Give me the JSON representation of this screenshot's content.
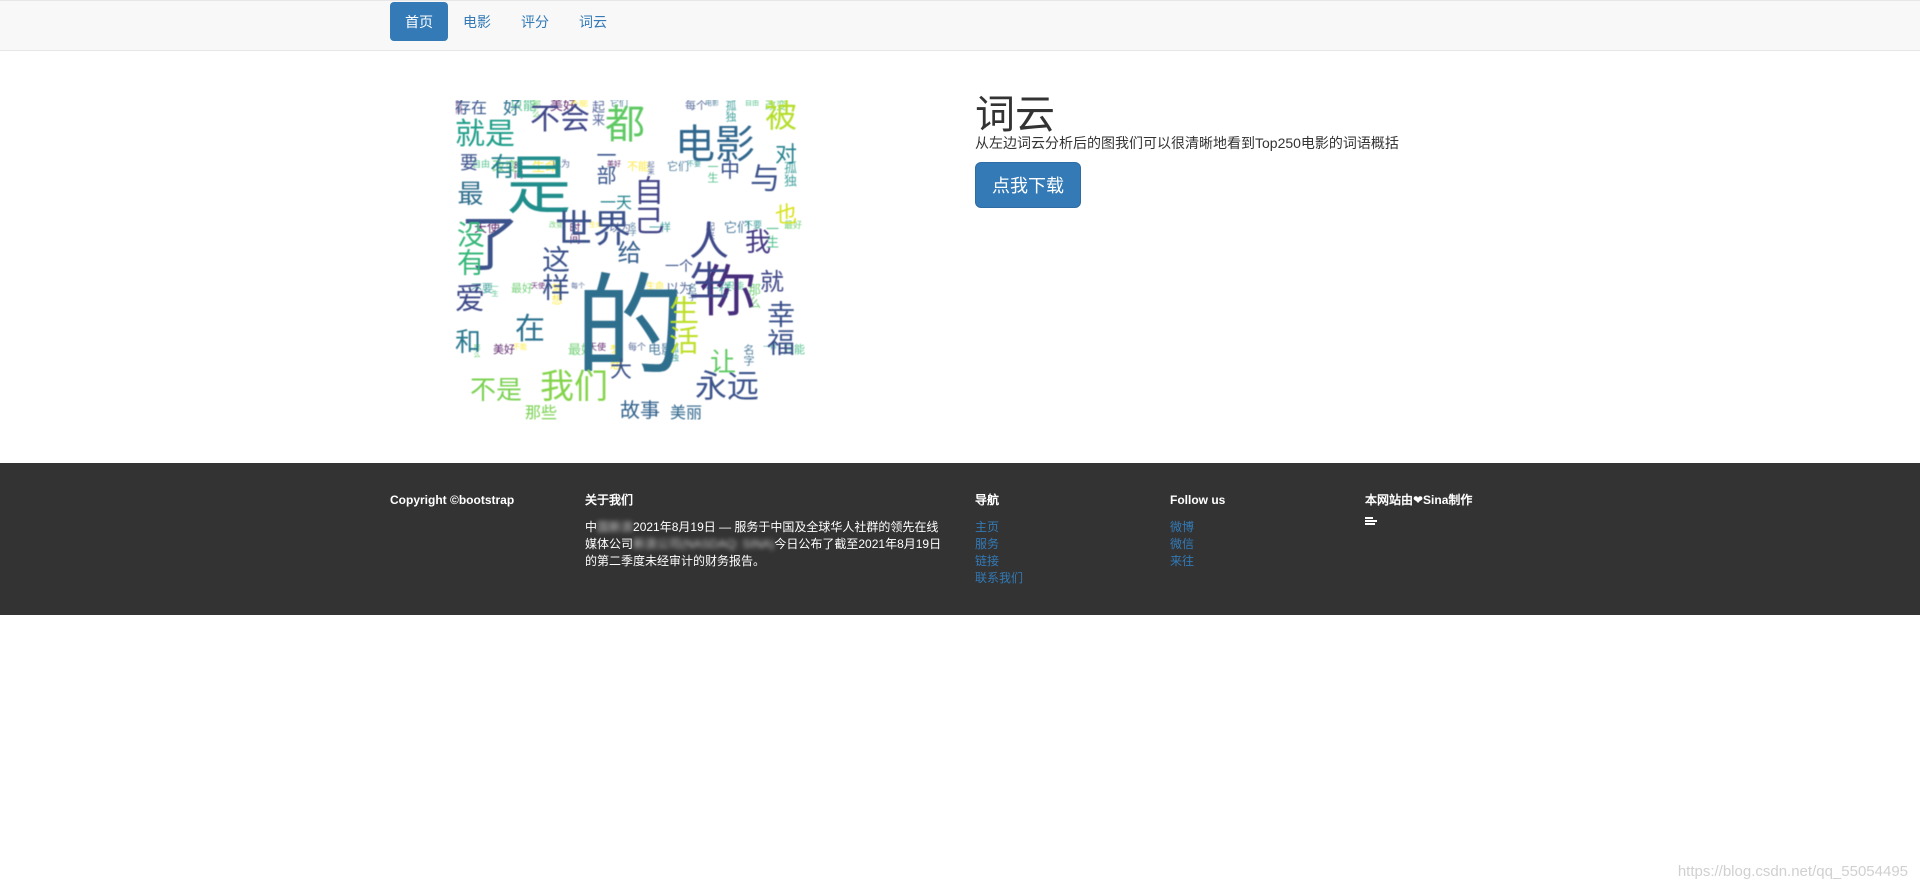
{
  "nav": {
    "items": [
      "首页",
      "电影",
      "评分",
      "词云"
    ],
    "active": 0
  },
  "main": {
    "title": "词云",
    "description": "从左边词云分析后的图我们可以很清晰地看到Top250电影的词语概括",
    "download_label": "点我下载"
  },
  "wordcloud": {
    "words": [
      "的",
      "是",
      "了",
      "你",
      "人生",
      "世界",
      "电影",
      "我们",
      "永远",
      "都",
      "不会",
      "就是",
      "被",
      "与",
      "自己",
      "没有",
      "爱",
      "在",
      "这样",
      "和",
      "有",
      "最",
      "幸福",
      "生活",
      "给",
      "我",
      "就",
      "让",
      "不是",
      "故事",
      "美丽",
      "一个",
      "中",
      "一部",
      "对",
      "也",
      "存在",
      "好",
      "要",
      "一天",
      "大",
      "那些"
    ]
  },
  "footer": {
    "copyright": "Copyright ©bootstrap",
    "about": {
      "heading": "关于我们",
      "text_a": "中",
      "text_blur1": "国新浪",
      "text_b": "2021年8月19日 — 服务于中国及全球华人社群的领先在线媒体公司",
      "text_blur2": "新浪公司(NASDAQ: SINA)",
      "text_c": "今日公布了截至2021年8月19日的第二季度未经审计的财务报告。"
    },
    "nav": {
      "heading": "导航",
      "links": [
        "主页",
        "服务",
        "链接",
        "联系我们"
      ]
    },
    "follow": {
      "heading": "Follow us",
      "links": [
        "微博",
        "微信",
        "来往"
      ]
    },
    "made_by": "本网站由❤Sina制作"
  },
  "watermark": "https://blog.csdn.net/qq_55054495"
}
